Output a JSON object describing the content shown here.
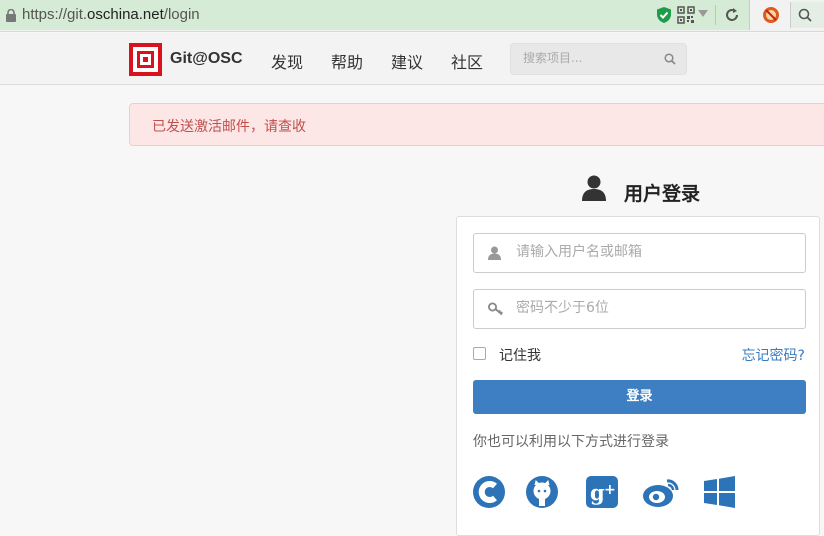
{
  "browser": {
    "url_prefix": "https://git.",
    "url_domain": "oschina.net",
    "url_path": "/login",
    "security_color": "#1f9c4a"
  },
  "nav": {
    "brand": "Git@OSC",
    "items": [
      {
        "label": "发现"
      },
      {
        "label": "帮助"
      },
      {
        "label": "建议"
      },
      {
        "label": "社区"
      }
    ],
    "search_placeholder": "搜索项目...",
    "logo_color": "#d9121f"
  },
  "alert": {
    "message": "已发送激活邮件，请查收"
  },
  "login": {
    "title": "用户登录",
    "username_placeholder": "请输入用户名或邮箱",
    "password_placeholder": "密码不少于6位",
    "remember_label": "记住我",
    "forgot_label": "忘记密码?",
    "submit_label": "登录",
    "alt_text": "你也可以利用以下方式进行登录",
    "providers": [
      "csdn-icon",
      "github-icon",
      "google-plus-icon",
      "weibo-icon",
      "windows-icon"
    ],
    "accent_color": "#3d7fc2"
  }
}
